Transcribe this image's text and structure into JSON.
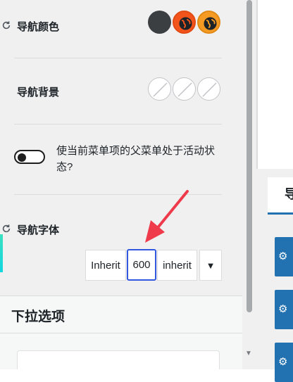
{
  "settings": {
    "nav_color": {
      "label": "导航颜色",
      "swatches": [
        {
          "color": "#3c3f42"
        },
        {
          "color": "#f2541b",
          "icon": "globe-icon"
        },
        {
          "color": "#f59a23",
          "icon": "globe-icon"
        }
      ]
    },
    "nav_background": {
      "label": "导航背景",
      "swatches": [
        "empty",
        "empty",
        "empty"
      ]
    },
    "parent_active": {
      "text": "使当前菜单项的父菜单处于活动状态?",
      "enabled": false
    },
    "nav_font": {
      "label": "导航字体",
      "family": "Inherit",
      "weight": "600",
      "transform": "inherit",
      "dropdown_glyph": "▼"
    }
  },
  "dropdown_section": {
    "title": "下拉选项"
  },
  "side_panel": {
    "tab_glyph": "导"
  },
  "colors": {
    "accent_blue": "#2271b1",
    "highlight_border": "#3358e0",
    "annotation_arrow": "#ee3a4a"
  }
}
